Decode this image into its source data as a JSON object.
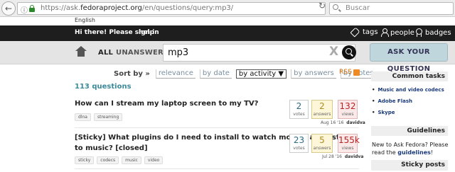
{
  "browser": {
    "url_prefix": "https://ask.",
    "url_domain": "fedoraproject.org",
    "url_path": "/en/questions/query:mp3/",
    "search_placeholder": "Buscar"
  },
  "header": {
    "language": "English",
    "greeting": "Hi there! Please sign in",
    "help": "help",
    "nav": {
      "tags": "tags",
      "people": "people",
      "badges": "badges"
    }
  },
  "search": {
    "scope_all": "ALL",
    "scope_unanswered": "UNANSWERED",
    "query": "mp3",
    "clear": "X",
    "ask_button": "ASK YOUR QUESTION"
  },
  "sort": {
    "label": "Sort by »",
    "options": [
      "relevance",
      "by date",
      "by activity ▼",
      "by answers",
      "by votes"
    ],
    "active_index": 2,
    "rss": "RSS"
  },
  "results_count": "113 questions",
  "questions": [
    {
      "title": "How can I stream my laptop screen to my TV?",
      "tags": [
        "dlna",
        "streaming"
      ],
      "votes": "2",
      "votes_label": "votes",
      "answers": "2",
      "answers_label": "answers",
      "views": "132",
      "views_label": "views",
      "date": "Aug 16 '16",
      "user": "davidva"
    },
    {
      "title_line1": "[Sticky] What plugins do I need to install to watch movies and listen",
      "title_line2": "to music? [closed]",
      "tags": [
        "sticky",
        "codecs",
        "music",
        "video"
      ],
      "votes": "23",
      "votes_label": "votes",
      "answers": "5",
      "answers_label": "answers",
      "views": "155k",
      "views_label": "views",
      "date": "Jul 28 '16",
      "user": "davidva"
    }
  ],
  "sidebar": {
    "common_tasks_title": "Common tasks",
    "links": [
      "Music and video codecs",
      "Adobe Flash",
      "Skype"
    ],
    "guidelines_title": "Guidelines",
    "guidelines_text_a": "New to Ask Fedora? Please",
    "guidelines_text_b": "read the",
    "guidelines_link": "guidelines",
    "guidelines_end": "!",
    "sticky_title": "Sticky posts"
  }
}
